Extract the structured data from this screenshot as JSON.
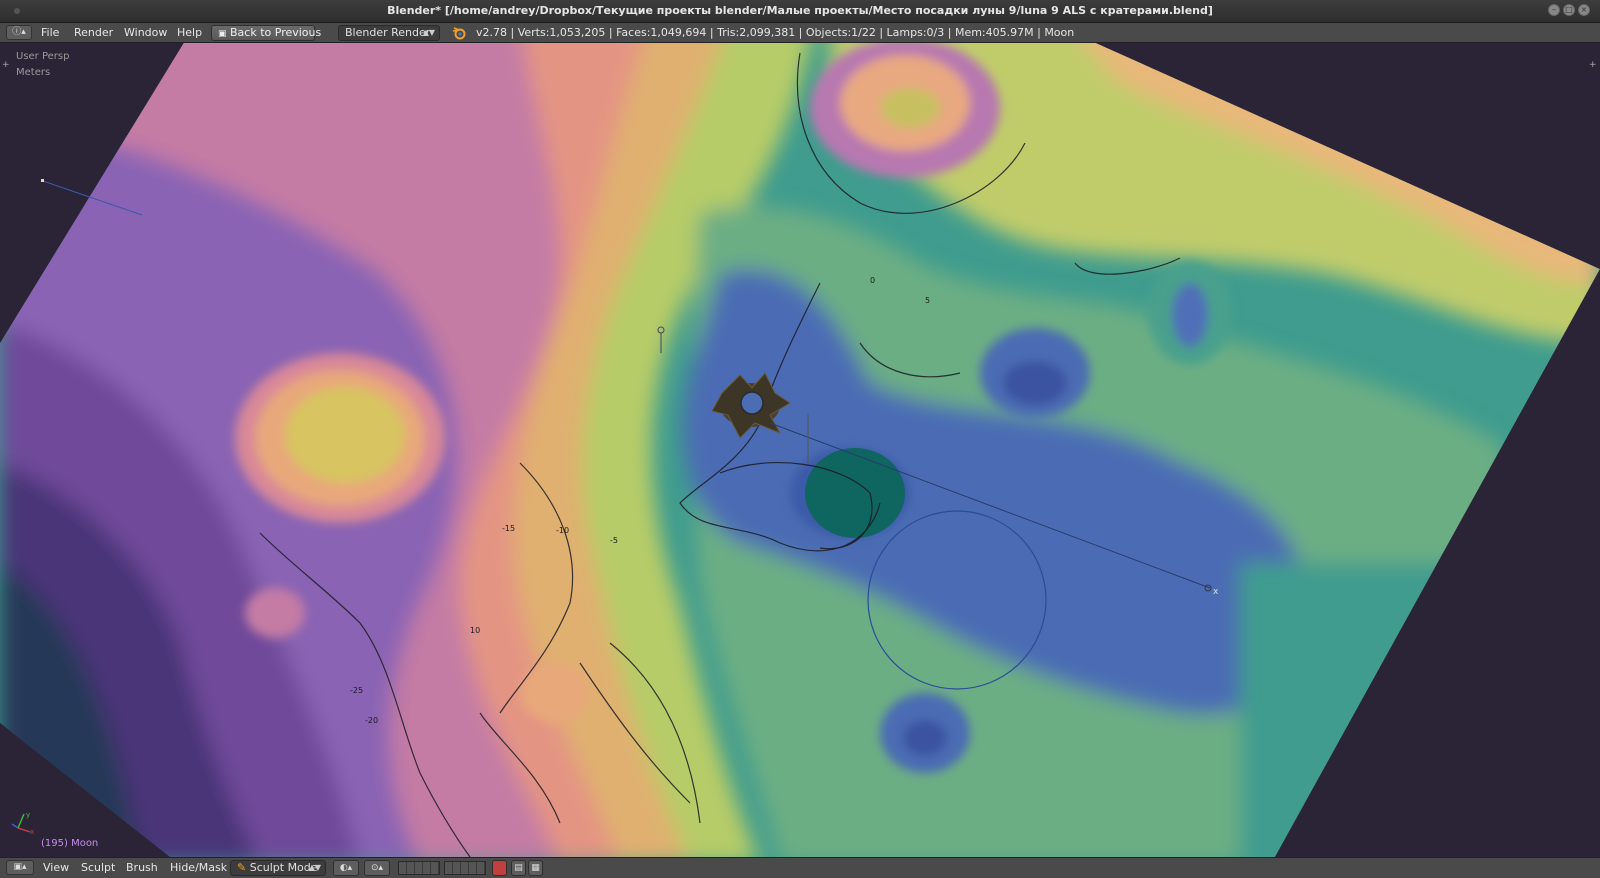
{
  "window": {
    "title": "Blender* [/home/andrey/Dropbox/Текущие проекты blender/Малые проекты/Место посадки луны 9/luna  9 ALS с кратерами.blend]"
  },
  "info_header": {
    "menus": [
      "File",
      "Render",
      "Window",
      "Help"
    ],
    "back_button": "Back to Previous",
    "render_engine": "Blender Render",
    "stats": "v2.78 | Verts:1,053,205 | Faces:1,049,694 | Tris:2,099,381 | Objects:1/22 | Lamps:0/3 | Mem:405.97M | Moon"
  },
  "viewport": {
    "view_name": "User Persp",
    "units": "Meters",
    "object_info": "(195) Moon",
    "axis_labels": {
      "x": "x",
      "y": "y"
    },
    "contour_labels": [
      "-15",
      "-10",
      "-5",
      "0",
      "5",
      "10",
      "-20",
      "-25"
    ]
  },
  "bottom_header": {
    "menus": [
      "View",
      "Sculpt",
      "Brush",
      "Hide/Mask"
    ],
    "mode": "Sculpt Mode"
  },
  "colors": {
    "background": "#2b2336",
    "header": "#4a4a4a",
    "object_info_text": "#c88cf0"
  }
}
